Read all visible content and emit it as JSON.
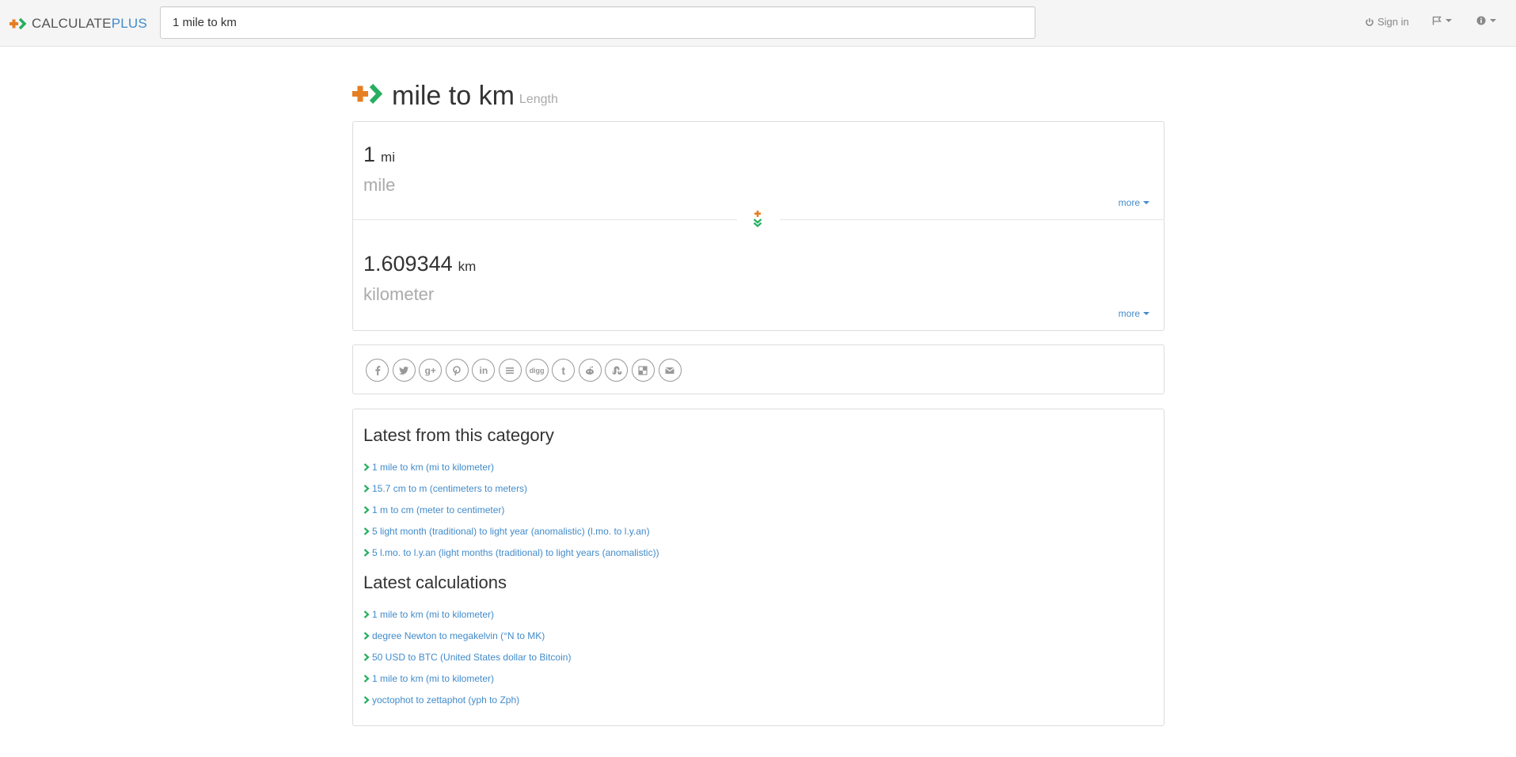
{
  "navbar": {
    "brand_calculate": "CALCULATE",
    "brand_plus": "PLUS",
    "search_value": "1 mile to km",
    "sign_in": "Sign in"
  },
  "page": {
    "title": "mile to km",
    "subtitle": "Length"
  },
  "conversion": {
    "from": {
      "value": "1",
      "abbr": "mi",
      "name": "mile",
      "more": "more"
    },
    "to": {
      "value": "1.609344",
      "abbr": "km",
      "name": "kilometer",
      "more": "more"
    }
  },
  "share": {
    "icons": [
      "facebook-icon",
      "twitter-icon",
      "google-plus-icon",
      "pinterest-icon",
      "linkedin-icon",
      "buffer-icon",
      "digg-icon",
      "tumblr-icon",
      "reddit-icon",
      "stumbleupon-icon",
      "delicious-icon",
      "email-icon"
    ]
  },
  "latest_category": {
    "title": "Latest from this category",
    "items": [
      "1 mile to km (mi to kilometer)",
      "15.7 cm to m (centimeters to meters)",
      "1 m to cm (meter to centimeter)",
      "5 light month (traditional) to light year (anomalistic) (l.mo. to l.y.an)",
      "5 l.mo. to l.y.an (light months (traditional) to light years (anomalistic))"
    ]
  },
  "latest_calculations": {
    "title": "Latest calculations",
    "items": [
      "1 mile to km (mi to kilometer)",
      "degree Newton to megakelvin (°N to MK)",
      "50 USD to BTC (United States dollar to Bitcoin)",
      "1 mile to km (mi to kilometer)",
      "yoctophot to zettaphot (yph to Zph)"
    ]
  },
  "colors": {
    "orange": "#e67e22",
    "green": "#27ae60",
    "link": "#428bca"
  }
}
